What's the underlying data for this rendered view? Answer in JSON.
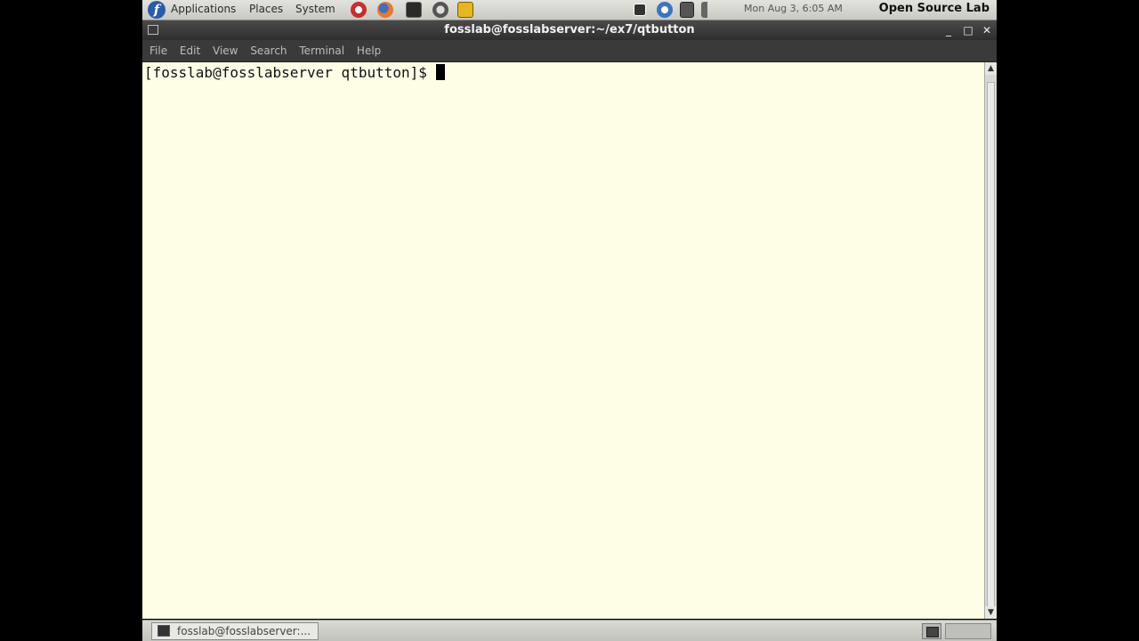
{
  "top_panel": {
    "menus": [
      "Applications",
      "Places",
      "System"
    ],
    "clock": "Mon Aug 3, 6:05 AM",
    "brand": "Open Source Lab"
  },
  "window": {
    "title": "fosslab@fosslabserver:~/ex7/qtbutton",
    "menu": [
      "File",
      "Edit",
      "View",
      "Search",
      "Terminal",
      "Help"
    ],
    "controls": {
      "minimize": "_",
      "maximize": "□",
      "close": "✕"
    }
  },
  "terminal": {
    "prompt": "[fosslab@fosslabserver qtbutton]$"
  },
  "taskbar": {
    "task_label": "fosslab@fosslabserver:..."
  },
  "colors": {
    "terminal_bg": "#fefee6",
    "titlebar": "#3a3a3a",
    "panel": "#d4d4d0"
  },
  "icons": [
    "fedora-logo-icon",
    "help-icon",
    "firefox-icon",
    "mail-icon",
    "network-icon",
    "notes-icon",
    "terminal-icon",
    "update-icon",
    "printer-icon",
    "volume-icon",
    "scroll-up-icon",
    "scroll-down-icon",
    "show-desktop-icon"
  ]
}
